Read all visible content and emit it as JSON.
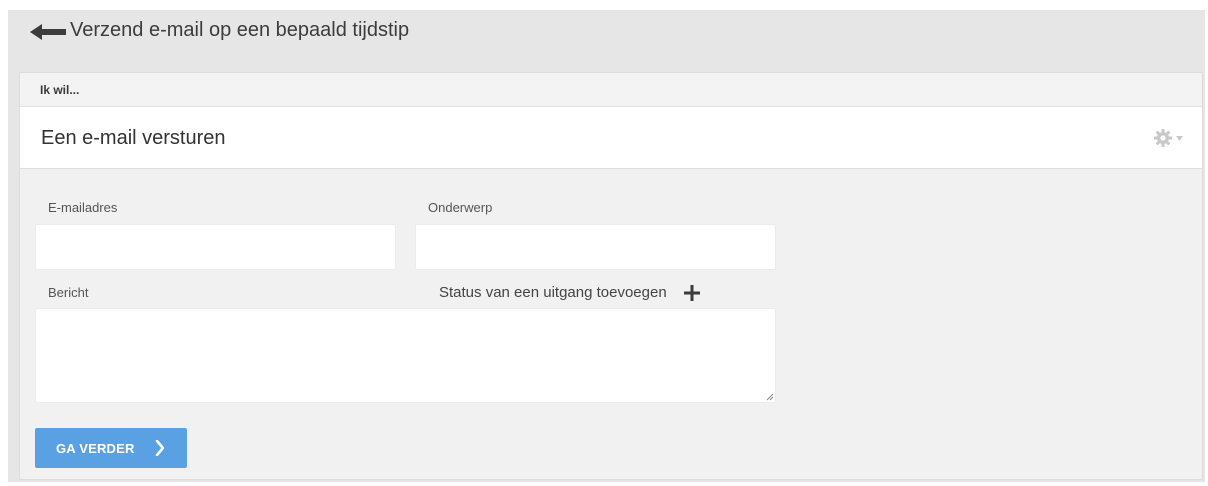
{
  "header": {
    "title": "Verzend e-mail op een bepaald tijdstip",
    "back_icon": "arrow-left-icon"
  },
  "section": {
    "label": "Ik wil..."
  },
  "action": {
    "title": "Een e-mail versturen",
    "settings_icon": "gear-icon"
  },
  "form": {
    "email_label": "E-mailadres",
    "email_value": "",
    "subject_label": "Onderwerp",
    "subject_value": "",
    "message_label": "Bericht",
    "message_value": "",
    "add_exit_status_label": "Status van een uitgang toevoegen",
    "add_exit_status_icon": "plus-icon"
  },
  "footer": {
    "continue_label": "GA VERDER",
    "continue_icon": "chevron-right-icon"
  },
  "colors": {
    "accent": "#5aa1e3",
    "background": "#e6e6e6",
    "card": "#f1f1f1"
  }
}
